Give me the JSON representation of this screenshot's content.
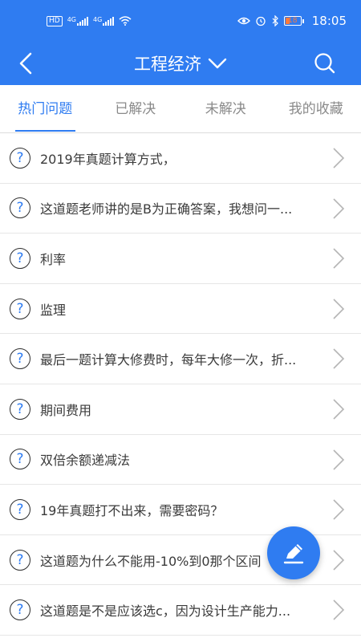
{
  "status_bar": {
    "hd_label": "HD",
    "net1": "4G",
    "net2": "4G",
    "battery": "18",
    "time": "18:05"
  },
  "navbar": {
    "title": "工程经济"
  },
  "tabs": [
    {
      "label": "热门问题",
      "active": true
    },
    {
      "label": "已解决",
      "active": false
    },
    {
      "label": "未解决",
      "active": false
    },
    {
      "label": "我的收藏",
      "active": false
    }
  ],
  "questions": [
    {
      "icon": "?",
      "text": "2019年真题计算方式，"
    },
    {
      "icon": "?",
      "text": "这道题老师讲的是B为正确答案，我想问一..."
    },
    {
      "icon": "?",
      "text": "利率"
    },
    {
      "icon": "?",
      "text": "监理"
    },
    {
      "icon": "?",
      "text": "最后一题计算大修费时，每年大修一次，折..."
    },
    {
      "icon": "?",
      "text": "期间费用"
    },
    {
      "icon": "?",
      "text": "双倍余额递减法"
    },
    {
      "icon": "?",
      "text": "19年真题打不出来，需要密码？"
    },
    {
      "icon": "?",
      "text": "这道题为什么不能用-10%到0那个区间"
    },
    {
      "icon": "?",
      "text": "这道题是不是应该选c，因为设计生产能力..."
    }
  ],
  "colors": {
    "accent": "#2f7cf1",
    "header_bg": "#2f7cf1",
    "text": "#3a3a3a",
    "tab_inactive": "#8a8a8a"
  }
}
